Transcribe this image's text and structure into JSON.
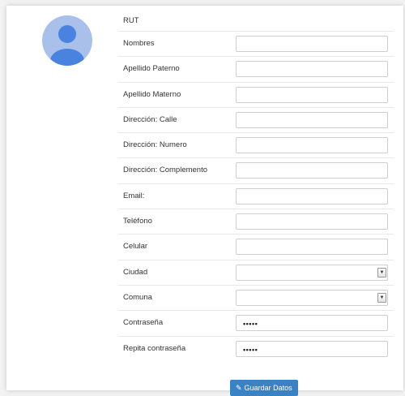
{
  "form": {
    "fields": [
      {
        "label": "RUT",
        "type": "none",
        "value": ""
      },
      {
        "label": "Nombres",
        "type": "text",
        "value": ""
      },
      {
        "label": "Apellido Paterno",
        "type": "text",
        "value": ""
      },
      {
        "label": "Apellido Materno",
        "type": "text",
        "value": ""
      },
      {
        "label": "Dirección: Calle",
        "type": "text",
        "value": ""
      },
      {
        "label": "Dirección: Numero",
        "type": "text",
        "value": ""
      },
      {
        "label": "Dirección: Complemento",
        "type": "text",
        "value": ""
      },
      {
        "label": "Email:",
        "type": "text",
        "value": ""
      },
      {
        "label": "Teléfono",
        "type": "text",
        "value": ""
      },
      {
        "label": "Celular",
        "type": "text",
        "value": ""
      },
      {
        "label": "Ciudad",
        "type": "select",
        "value": ""
      },
      {
        "label": "Comuna",
        "type": "select",
        "value": ""
      },
      {
        "label": "Contraseña",
        "type": "password",
        "value": "•••••"
      },
      {
        "label": "Repita contraseña",
        "type": "password",
        "value": "•••••"
      }
    ],
    "submit_label": "Guardar Datos",
    "submit_icon": "edit-icon"
  },
  "colors": {
    "accent": "#3a82c4",
    "avatar_bg": "#a9c1ea",
    "avatar_fg": "#4a83df"
  }
}
